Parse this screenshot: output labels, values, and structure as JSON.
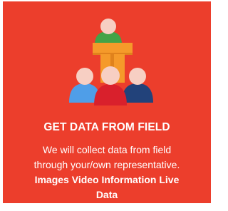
{
  "card": {
    "title": "GET DATA FROM FIELD",
    "description_line1": "We will collect data from field",
    "description_line2": "through your/own representative.",
    "highlight_line1": "Images Video Information Live",
    "highlight_line2": "Data"
  },
  "colors": {
    "background": "#ec3e2c",
    "podium": "#f59a2a",
    "podium_shade": "#e0821c",
    "skin": "#f7cfc3",
    "speaker_shirt": "#43a347",
    "left_shirt": "#4f9ee8",
    "center_shirt": "#d9202c",
    "right_shirt": "#22427a"
  },
  "icons": {
    "illustration": "speaker-at-podium-with-audience-icon"
  }
}
